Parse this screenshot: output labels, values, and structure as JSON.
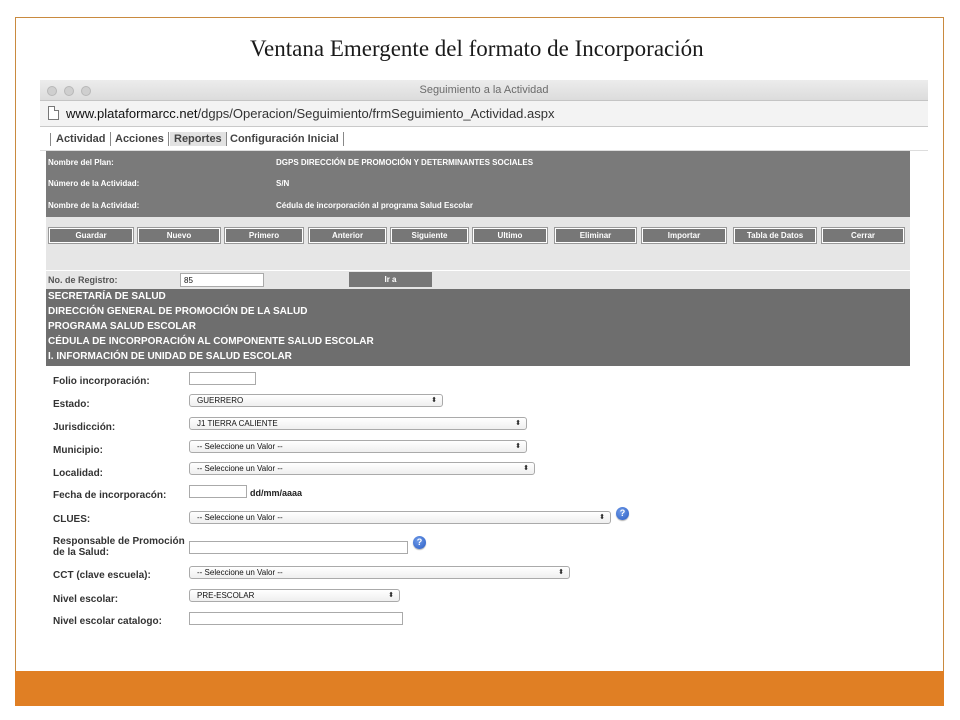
{
  "slide": {
    "title": "Ventana Emergente del formato de Incorporación",
    "accent_color": "#e07f24"
  },
  "browser": {
    "window_title": "Seguimiento a la Actividad",
    "url_host": "www.plataformarcc.net",
    "url_path": "/dgps/Operacion/Seguimiento/frmSeguimiento_Actividad.aspx",
    "page_icon": "document-icon"
  },
  "menu": {
    "items": [
      {
        "label": "Actividad",
        "active": false
      },
      {
        "label": "Acciones",
        "active": false
      },
      {
        "label": "Reportes",
        "active": true
      },
      {
        "label": "Configuración Inicial",
        "active": false
      }
    ]
  },
  "plan": {
    "rows": [
      {
        "label": "Nombre del Plan:",
        "value": "DGPS DIRECCIÓN DE PROMOCIÓN Y DETERMINANTES SOCIALES"
      },
      {
        "label": "Número de la Actividad:",
        "value": "S/N"
      },
      {
        "label": "Nombre de la Actividad:",
        "value": "Cédula de incorporación al programa Salud Escolar"
      }
    ]
  },
  "actions": {
    "buttons": [
      "Guardar",
      "Nuevo",
      "Primero",
      "Anterior",
      "Siguiente",
      "Ultimo",
      "Eliminar",
      "Importar",
      "Tabla de Datos",
      "Cerrar"
    ]
  },
  "registro": {
    "label": "No. de Registro:",
    "value": "85",
    "go_label": "Ir a"
  },
  "headings": [
    "SECRETARÍA DE SALUD",
    "DIRECCIÓN GENERAL DE PROMOCIÓN DE LA SALUD",
    "PROGRAMA SALUD ESCOLAR",
    "CÉDULA DE INCORPORACIÓN AL COMPONENTE SALUD ESCOLAR",
    "I. INFORMACIÓN DE UNIDAD DE SALUD ESCOLAR"
  ],
  "form": {
    "folio": {
      "label": "Folio incorporación:",
      "value": ""
    },
    "estado": {
      "label": "Estado:",
      "value": "GUERRERO"
    },
    "jurisdiccion": {
      "label": "Jurisdicción:",
      "value": "J1 TIERRA CALIENTE"
    },
    "municipio": {
      "label": "Municipio:",
      "value": "-- Seleccione un Valor --"
    },
    "localidad": {
      "label": "Localidad:",
      "value": "-- Seleccione un Valor --"
    },
    "fecha": {
      "label": "Fecha de incorporacón:",
      "value": "",
      "format_hint": "dd/mm/aaaa"
    },
    "clues": {
      "label": "CLUES:",
      "value": "-- Seleccione un Valor --"
    },
    "responsable": {
      "label": "Responsable de Promoción de la Salud:",
      "value": ""
    },
    "cct": {
      "label": "CCT (clave escuela):",
      "value": "-- Seleccione un Valor --"
    },
    "nivel": {
      "label": "Nivel escolar:",
      "value": "PRE-ESCOLAR"
    },
    "nivel_catalogo": {
      "label": "Nivel escolar catalogo:",
      "value": ""
    },
    "help_glyph": "?",
    "select_glyph": "⬍"
  }
}
